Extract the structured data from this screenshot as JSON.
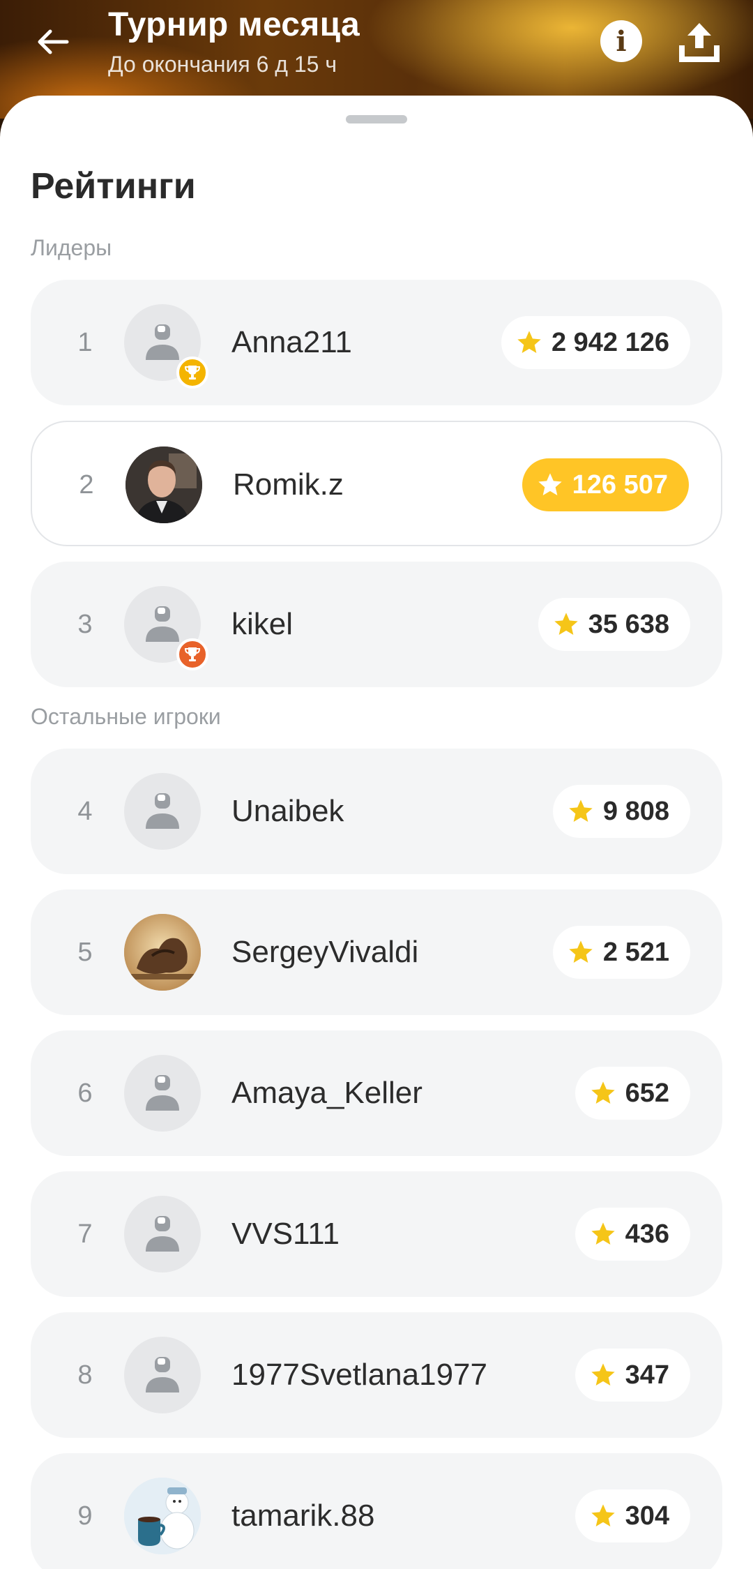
{
  "header": {
    "title": "Турнир месяца",
    "subtitle": "До окончания 6 д 15 ч",
    "info_glyph": "i"
  },
  "sheet": {
    "title": "Рейтинги",
    "leaders_label": "Лидеры",
    "others_label": "Остальные игроки"
  },
  "colors": {
    "accent": "#ffc526",
    "gold_trophy": "#f4b400",
    "bronze_trophy": "#e8622a",
    "row_bg": "#f4f5f6"
  },
  "players": [
    {
      "rank": "1",
      "name": "Anna211",
      "score": "2 942 126",
      "avatar": "placeholder",
      "trophy": "gold"
    },
    {
      "rank": "2",
      "name": "Romik.z",
      "score": "126 507",
      "avatar": "photo-portrait",
      "current_user": true
    },
    {
      "rank": "3",
      "name": "kikel",
      "score": "35 638",
      "avatar": "placeholder",
      "trophy": "bronze"
    },
    {
      "rank": "4",
      "name": "Unaibek",
      "score": "9 808",
      "avatar": "placeholder"
    },
    {
      "rank": "5",
      "name": "SergeyVivaldi",
      "score": "2 521",
      "avatar": "photo-sculpture"
    },
    {
      "rank": "6",
      "name": "Amaya_Keller",
      "score": "652",
      "avatar": "placeholder"
    },
    {
      "rank": "7",
      "name": "VVS111",
      "score": "436",
      "avatar": "placeholder"
    },
    {
      "rank": "8",
      "name": "1977Svetlana1977",
      "score": "347",
      "avatar": "placeholder"
    },
    {
      "rank": "9",
      "name": "tamarik.88",
      "score": "304",
      "avatar": "photo-snowman"
    }
  ]
}
